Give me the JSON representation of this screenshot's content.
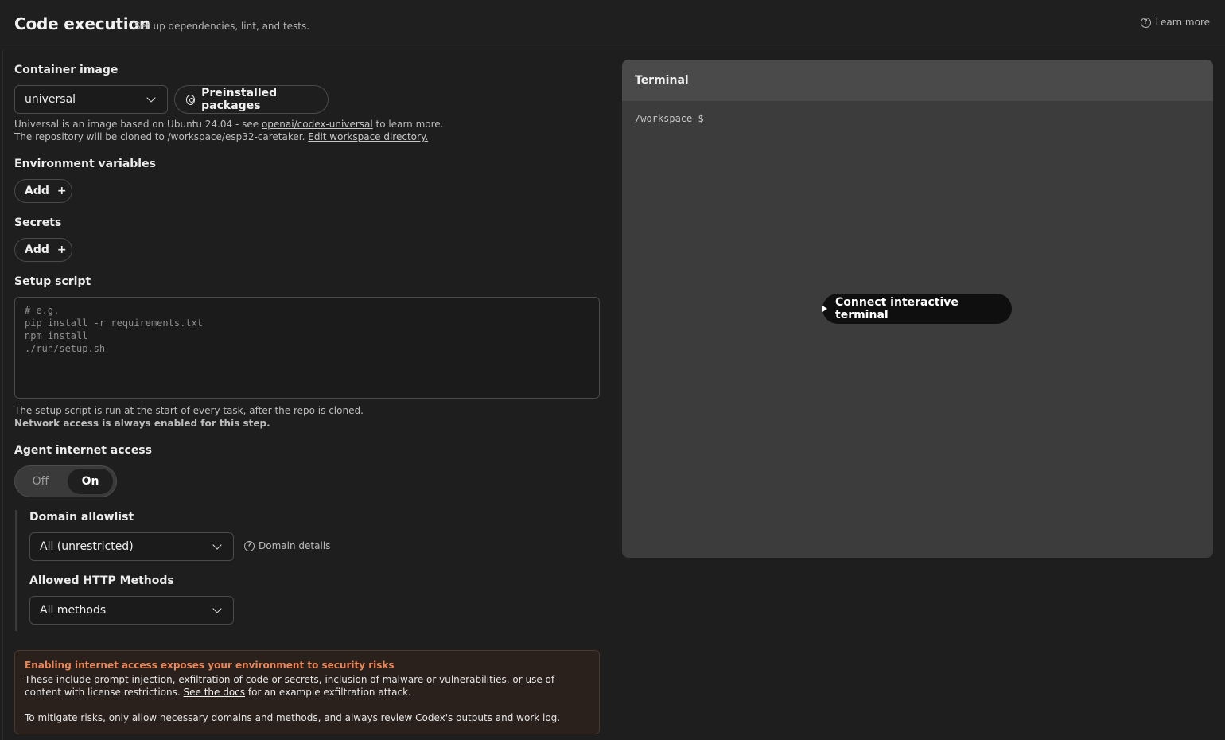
{
  "header": {
    "title": "Code execution",
    "subtitle": "Set up dependencies, lint, and tests.",
    "learn_more": "Learn more"
  },
  "container_image": {
    "label": "Container image",
    "selected": "universal",
    "preinstalled_button": "Preinstalled packages",
    "help_line1_prefix": "Universal is an image based on Ubuntu 24.04 - see",
    "help_line1_link": "openai/codex-universal",
    "help_line1_suffix": "to learn more.",
    "help_line2_prefix": "The repository will be cloned to /workspace/esp32-caretaker.",
    "help_line2_link": "Edit workspace directory."
  },
  "env_vars": {
    "label": "Environment variables",
    "add_button": "Add",
    "add_icon": "+"
  },
  "secrets": {
    "label": "Secrets",
    "add_button": "Add",
    "add_icon": "+"
  },
  "setup_script": {
    "label": "Setup script",
    "placeholder": "# e.g.\npip install -r requirements.txt\nnpm install\n./run/setup.sh",
    "help_line1": "The setup script is run at the start of every task, after the repo is cloned.",
    "help_line2": "Network access is always enabled for this step."
  },
  "internet_access": {
    "label": "Agent internet access",
    "off_label": "Off",
    "on_label": "On",
    "state": "On"
  },
  "domain_allowlist": {
    "label": "Domain allowlist",
    "selected": "All (unrestricted)",
    "details_link": "Domain details"
  },
  "http_methods": {
    "label": "Allowed HTTP Methods",
    "selected": "All methods"
  },
  "warning": {
    "title": "Enabling internet access exposes your environment to security risks",
    "body_prefix": "These include prompt injection, exfiltration of code or secrets, inclusion of malware or vulnerabilities, or use of content with license restrictions.",
    "body_link": "See the docs",
    "body_suffix": "for an example exfiltration attack.",
    "body2": "To mitigate risks, only allow necessary domains and methods, and always review Codex's outputs and work log.",
    "accent_color": "#e8875a"
  },
  "terminal": {
    "title": "Terminal",
    "prompt": "/workspace $",
    "connect_button": "Connect interactive terminal"
  }
}
